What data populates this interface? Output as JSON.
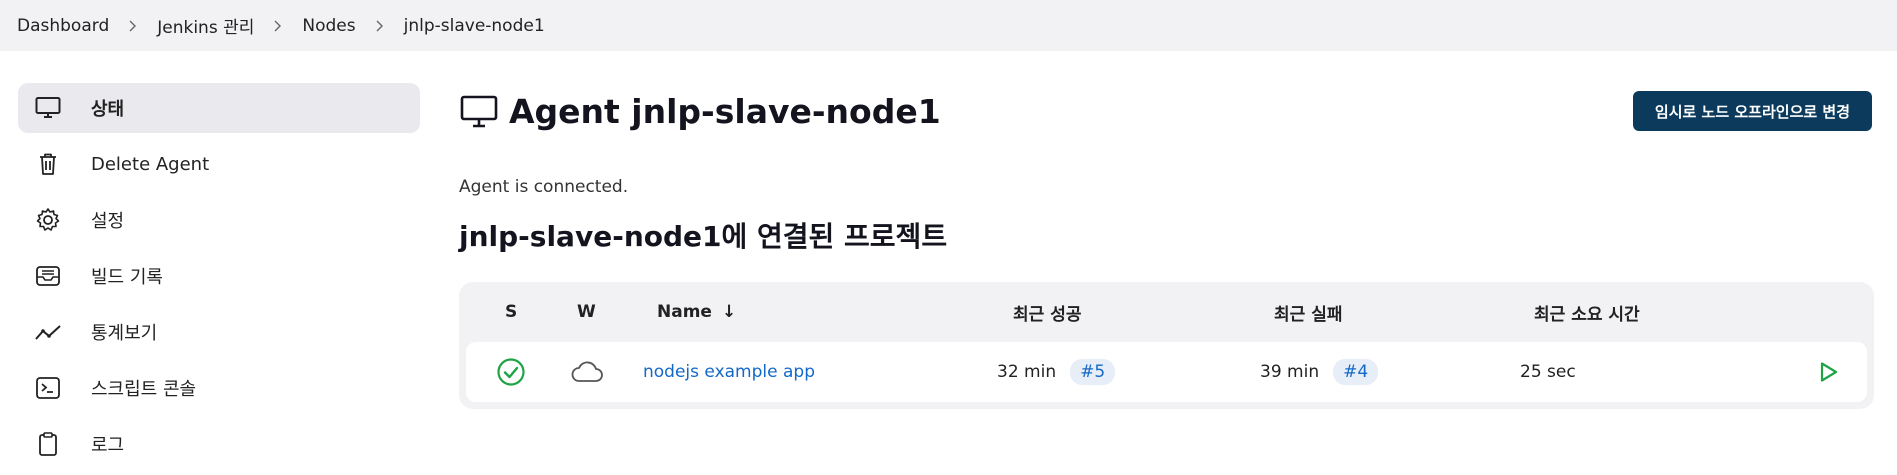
{
  "breadcrumb": [
    "Dashboard",
    "Jenkins 관리",
    "Nodes",
    "jnlp-slave-node1"
  ],
  "sidebar": {
    "items": [
      {
        "label": "상태",
        "icon": "monitor-icon",
        "active": true
      },
      {
        "label": "Delete Agent",
        "icon": "trash-icon",
        "active": false
      },
      {
        "label": "설정",
        "icon": "gear-icon",
        "active": false
      },
      {
        "label": "빌드 기록",
        "icon": "inbox-icon",
        "active": false
      },
      {
        "label": "통계보기",
        "icon": "trend-icon",
        "active": false
      },
      {
        "label": "스크립트 콘솔",
        "icon": "terminal-icon",
        "active": false
      },
      {
        "label": "로그",
        "icon": "clipboard-icon",
        "active": false
      }
    ]
  },
  "main": {
    "title": "Agent jnlp-slave-node1",
    "offline_button": "임시로 노드 오프라인으로 변경",
    "status": "Agent is connected.",
    "projects_title": "jnlp-slave-node1에 연결된 프로젝트"
  },
  "table": {
    "headers": {
      "s": "S",
      "w": "W",
      "name": "Name",
      "name_sort": "↓",
      "last_success": "최근 성공",
      "last_failure": "최근 실패",
      "last_duration": "최근 소요 시간"
    },
    "rows": [
      {
        "name": "nodejs example app",
        "success_time": "32 min",
        "success_build": "#5",
        "failure_time": "39 min",
        "failure_build": "#4",
        "duration": "25 sec"
      }
    ]
  },
  "colors": {
    "accent": "#0b3a5c",
    "link": "#1469c7",
    "success": "#1ea446"
  }
}
